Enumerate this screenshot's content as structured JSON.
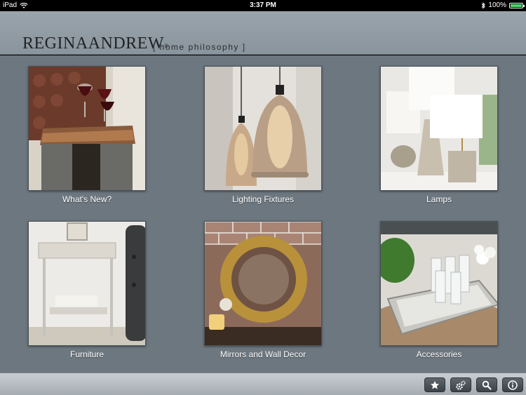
{
  "status": {
    "device": "iPad",
    "time": "3:37 PM",
    "battery": "100%",
    "battery_level": 1.0
  },
  "header": {
    "brand_main": "REGINA",
    "brand_second": "ANDREW",
    "brand_mark": "®",
    "tagline": "[ home philosophy ]"
  },
  "categories": [
    {
      "label": "What's New?"
    },
    {
      "label": "Lighting Fixtures"
    },
    {
      "label": "Lamps"
    },
    {
      "label": "Furniture"
    },
    {
      "label": "Mirrors and Wall Decor"
    },
    {
      "label": "Accessories"
    }
  ],
  "toolbar": {
    "buttons": [
      "star-icon",
      "gear-icon",
      "search-icon",
      "info-icon"
    ]
  },
  "colors": {
    "background": "#6d777f",
    "header": "#8f99a1",
    "toolbar": "#b8bec3",
    "label": "#ffffff"
  }
}
